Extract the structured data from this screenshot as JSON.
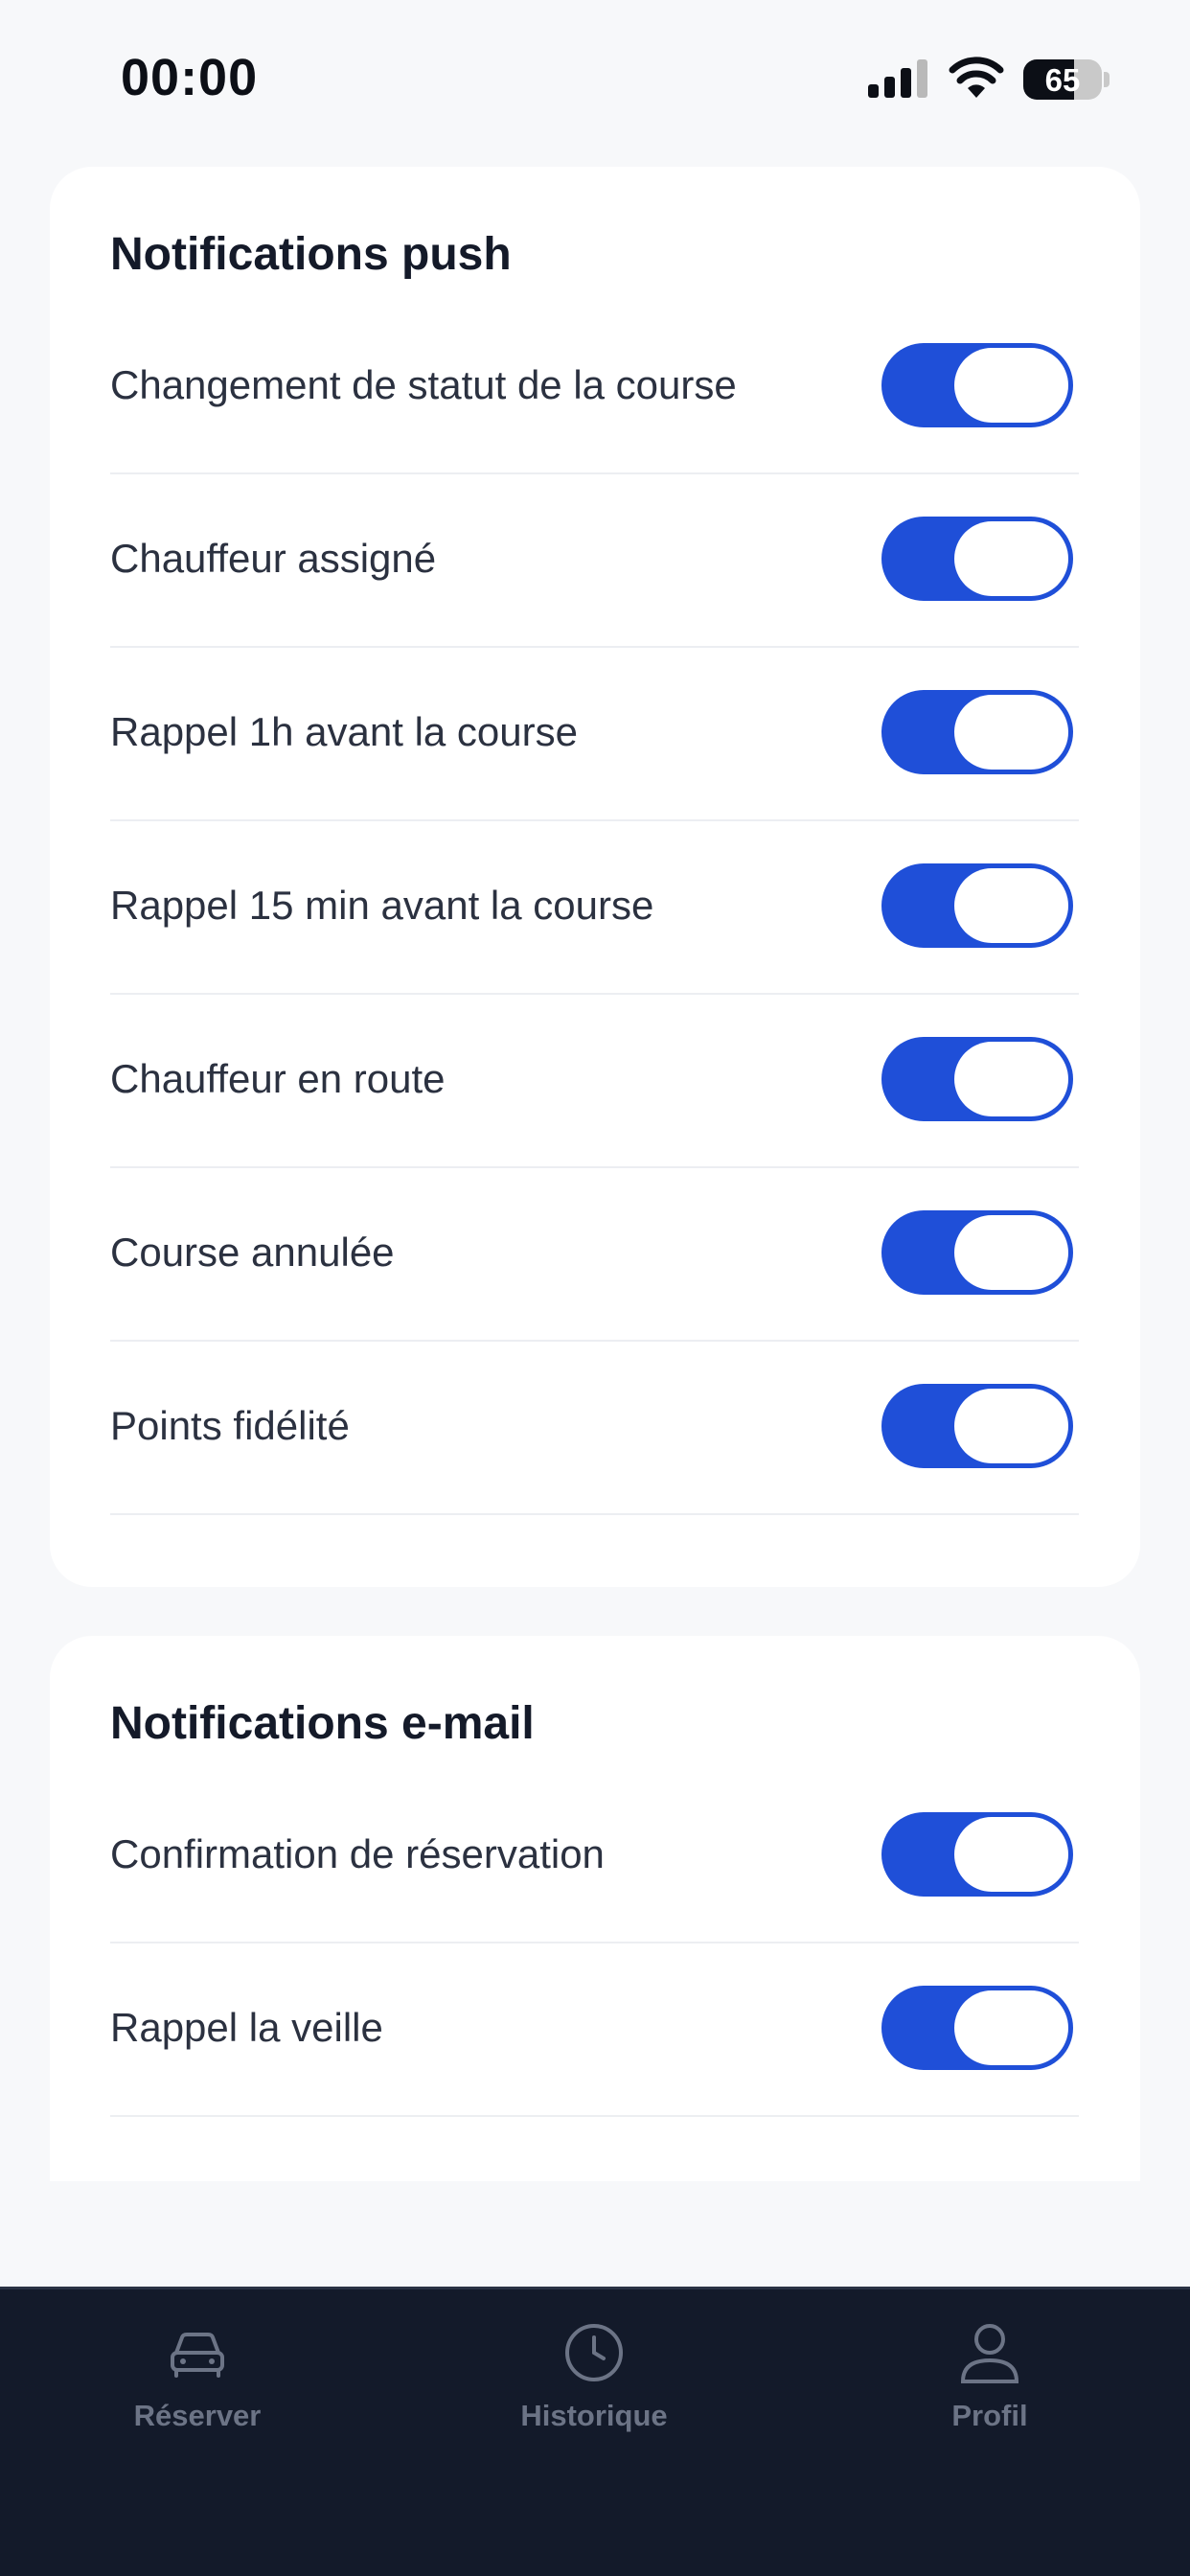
{
  "status_bar": {
    "time": "00:00",
    "battery_level": "65",
    "battery_fraction": 0.65
  },
  "push_section": {
    "title": "Notifications push",
    "items": [
      {
        "label": "Changement de statut de la course",
        "enabled": true
      },
      {
        "label": "Chauffeur assigné",
        "enabled": true
      },
      {
        "label": "Rappel 1h avant la course",
        "enabled": true
      },
      {
        "label": "Rappel 15 min avant la course",
        "enabled": true
      },
      {
        "label": "Chauffeur en route",
        "enabled": true
      },
      {
        "label": "Course annulée",
        "enabled": true
      },
      {
        "label": "Points fidélité",
        "enabled": true
      }
    ]
  },
  "email_section": {
    "title": "Notifications e-mail",
    "items": [
      {
        "label": "Confirmation de réservation",
        "enabled": true
      },
      {
        "label": "Rappel la veille",
        "enabled": true
      }
    ]
  },
  "tab_bar": {
    "items": [
      {
        "label": "Réserver",
        "icon": "car-icon"
      },
      {
        "label": "Historique",
        "icon": "clock-icon"
      },
      {
        "label": "Profil",
        "icon": "user-icon"
      }
    ]
  },
  "colors": {
    "toggle_on": "#1f4fd8",
    "tab_bar_bg": "#131a2a",
    "tab_inactive": "#6c7486",
    "page_bg": "#f7f8fa"
  }
}
